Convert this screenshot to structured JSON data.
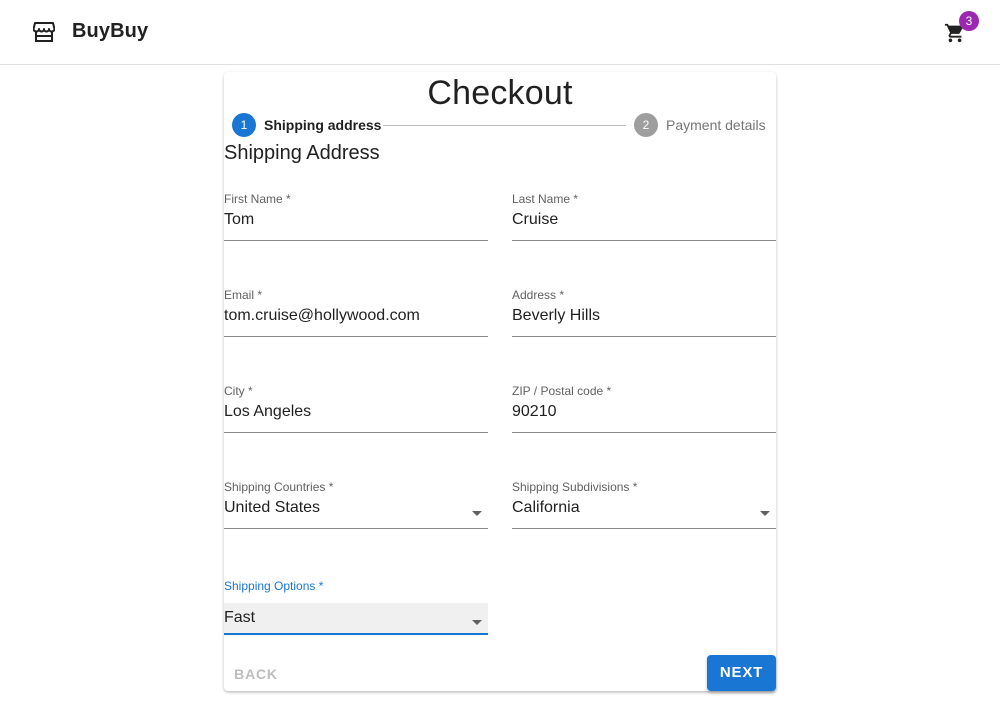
{
  "appbar": {
    "brand": "BuyBuy",
    "brand_icon": "storefront-icon",
    "cart_icon": "shopping-cart-icon",
    "cart_count": "3",
    "badge_color": "#9c27b0"
  },
  "checkout": {
    "title": "Checkout",
    "steps": [
      {
        "number": "1",
        "label": "Shipping address",
        "state": "active"
      },
      {
        "number": "2",
        "label": "Payment details",
        "state": "inactive"
      }
    ],
    "section_title": "Shipping Address",
    "fields": {
      "first_name": {
        "label": "First Name *",
        "value": "Tom"
      },
      "last_name": {
        "label": "Last Name *",
        "value": "Cruise"
      },
      "email": {
        "label": "Email *",
        "value": "tom.cruise@hollywood.com"
      },
      "address": {
        "label": "Address *",
        "value": "Beverly Hills"
      },
      "city": {
        "label": "City *",
        "value": "Los Angeles"
      },
      "zip": {
        "label": "ZIP / Postal code *",
        "value": "90210"
      },
      "country": {
        "label": "Shipping Countries *",
        "value": "United States"
      },
      "subdivision": {
        "label": "Shipping Subdivisions *",
        "value": "California"
      },
      "shipping_option": {
        "label": "Shipping Options *",
        "value": "Fast"
      }
    },
    "buttons": {
      "back": "BACK",
      "next": "NEXT"
    },
    "accent_color": "#1976d2"
  }
}
